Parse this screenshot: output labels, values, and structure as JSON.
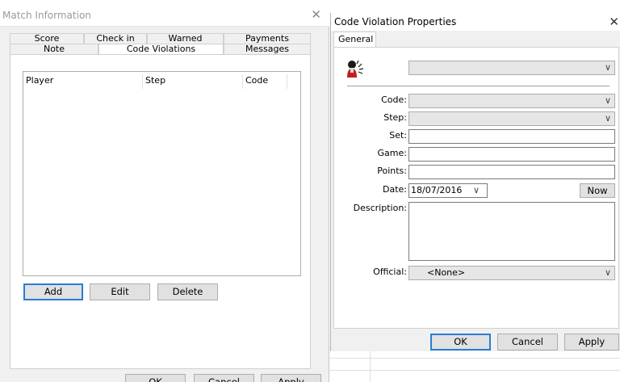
{
  "match_info": {
    "title": "Match Information",
    "close_glyph": "✕",
    "tabs_row1": [
      "Score",
      "Check in",
      "Warned",
      "Payments"
    ],
    "tabs_row2": [
      "Note",
      "Code Violations",
      "Messages"
    ],
    "active_tab": "Code Violations",
    "columns": [
      "Player",
      "Step",
      "Code"
    ],
    "buttons": {
      "add": "Add",
      "edit": "Edit",
      "delete": "Delete"
    },
    "footer_buttons": {
      "ok": "OK",
      "cancel": "Cancel",
      "apply": "Apply"
    }
  },
  "cvp": {
    "title": "Code Violation Properties",
    "close_glyph": "✕",
    "tab": "General",
    "person_icon": "player-violation-icon",
    "chevron": "∨",
    "labels": {
      "code": "Code:",
      "step": "Step:",
      "set": "Set:",
      "game": "Game:",
      "points": "Points:",
      "date": "Date:",
      "description": "Description:",
      "official": "Official:"
    },
    "values": {
      "date": "18/07/2016",
      "official": "<None>"
    },
    "now_button": "Now",
    "footer_buttons": {
      "ok": "OK",
      "cancel": "Cancel",
      "apply": "Apply"
    }
  },
  "colors": {
    "accent": "#2b7cd3",
    "window_bg": "#f0f0f0",
    "icon_red": "#c0201f"
  }
}
